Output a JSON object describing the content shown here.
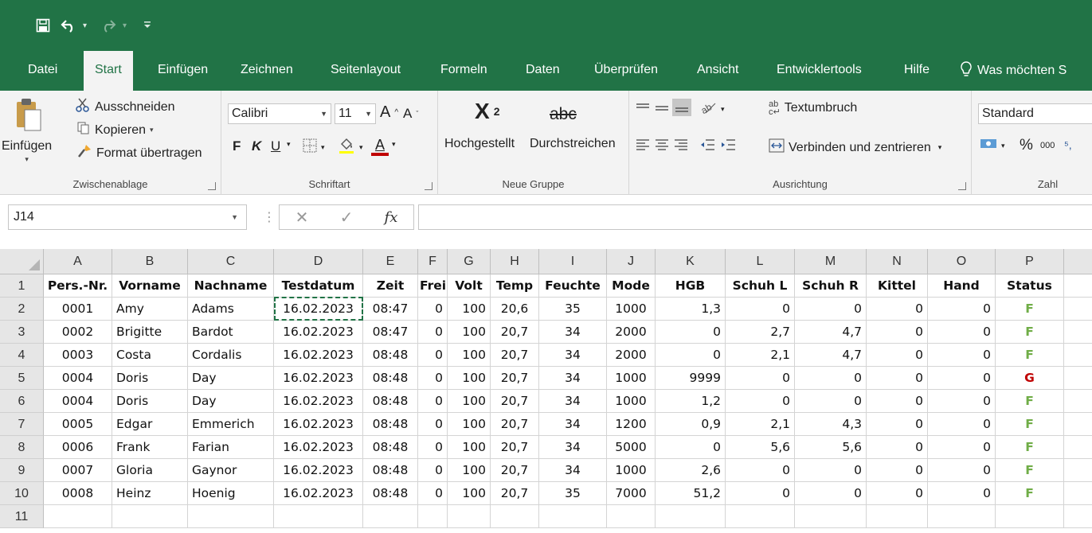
{
  "qat": {
    "save_icon": "save-icon",
    "undo_icon": "undo-icon",
    "redo_icon": "redo-icon"
  },
  "tabs": [
    "Datei",
    "Start",
    "Einfügen",
    "Zeichnen",
    "Seitenlayout",
    "Formeln",
    "Daten",
    "Überprüfen",
    "Ansicht",
    "Entwicklertools",
    "Hilfe"
  ],
  "active_tab": "Start",
  "tell_me": "Was möchten S",
  "clipboard": {
    "paste": "Einfügen",
    "cut": "Ausschneiden",
    "copy": "Kopieren",
    "format_painter": "Format übertragen",
    "label": "Zwischenablage"
  },
  "font": {
    "name": "Calibri",
    "size": "11",
    "bold": "F",
    "italic": "K",
    "underline": "U",
    "label": "Schriftart"
  },
  "custom_group": {
    "superscript": "Hochgestellt",
    "strikethrough": "Durchstreichen",
    "strike_sample": "abc",
    "label": "Neue Gruppe"
  },
  "alignment": {
    "wrap": "Textumbruch",
    "merge": "Verbinden und zentrieren",
    "label": "Ausrichtung"
  },
  "number": {
    "format": "Standard",
    "percent": "%",
    "thousands": "000",
    "label": "Zahl"
  },
  "formula_bar": {
    "name_box": "J14",
    "fx": "fx",
    "value": ""
  },
  "columns": [
    "A",
    "B",
    "C",
    "D",
    "E",
    "F",
    "G",
    "H",
    "I",
    "J",
    "K",
    "L",
    "M",
    "N",
    "O",
    "P"
  ],
  "row_numbers": [
    "1",
    "2",
    "3",
    "4",
    "5",
    "6",
    "7",
    "8",
    "9",
    "10",
    "11"
  ],
  "headers": [
    "Pers.-Nr.",
    "Vorname",
    "Nachname",
    "Testdatum",
    "Zeit",
    "Frei",
    "Volt",
    "Temp",
    "Feuchte",
    "Mode",
    "HGB",
    "Schuh L",
    "Schuh R",
    "Kittel",
    "Hand",
    "Status"
  ],
  "rows": [
    [
      "0001",
      "Amy",
      "Adams",
      "16.02.2023",
      "08:47",
      "0",
      "100",
      "20,6",
      "35",
      "1000",
      "1,3",
      "0",
      "0",
      "0",
      "0",
      "F"
    ],
    [
      "0002",
      "Brigitte",
      "Bardot",
      "16.02.2023",
      "08:47",
      "0",
      "100",
      "20,7",
      "34",
      "2000",
      "0",
      "2,7",
      "4,7",
      "0",
      "0",
      "F"
    ],
    [
      "0003",
      "Costa",
      "Cordalis",
      "16.02.2023",
      "08:48",
      "0",
      "100",
      "20,7",
      "34",
      "2000",
      "0",
      "2,1",
      "4,7",
      "0",
      "0",
      "F"
    ],
    [
      "0004",
      "Doris",
      "Day",
      "16.02.2023",
      "08:48",
      "0",
      "100",
      "20,7",
      "34",
      "1000",
      "9999",
      "0",
      "0",
      "0",
      "0",
      "G"
    ],
    [
      "0004",
      "Doris",
      "Day",
      "16.02.2023",
      "08:48",
      "0",
      "100",
      "20,7",
      "34",
      "1000",
      "1,2",
      "0",
      "0",
      "0",
      "0",
      "F"
    ],
    [
      "0005",
      "Edgar",
      "Emmerich",
      "16.02.2023",
      "08:48",
      "0",
      "100",
      "20,7",
      "34",
      "1200",
      "0,9",
      "2,1",
      "4,3",
      "0",
      "0",
      "F"
    ],
    [
      "0006",
      "Frank",
      "Farian",
      "16.02.2023",
      "08:48",
      "0",
      "100",
      "20,7",
      "34",
      "5000",
      "0",
      "5,6",
      "5,6",
      "0",
      "0",
      "F"
    ],
    [
      "0007",
      "Gloria",
      "Gaynor",
      "16.02.2023",
      "08:48",
      "0",
      "100",
      "20,7",
      "34",
      "1000",
      "2,6",
      "0",
      "0",
      "0",
      "0",
      "F"
    ],
    [
      "0008",
      "Heinz",
      "Hoenig",
      "16.02.2023",
      "08:48",
      "0",
      "100",
      "20,7",
      "35",
      "7000",
      "51,2",
      "0",
      "0",
      "0",
      "0",
      "F"
    ]
  ],
  "colors": {
    "accent": "#217346",
    "status_f": "#70ad47",
    "status_g": "#c00000"
  }
}
